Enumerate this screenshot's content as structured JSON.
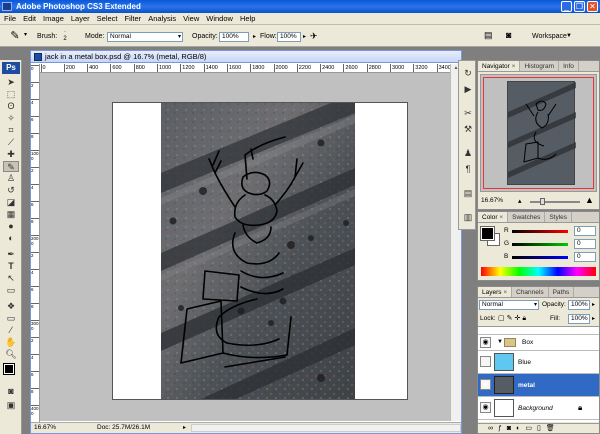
{
  "app": {
    "title": "Adobe Photoshop CS3 Extended",
    "logo": "Ps",
    "window_buttons": [
      "_",
      "❐",
      "✕"
    ]
  },
  "menu": [
    "File",
    "Edit",
    "Image",
    "Layer",
    "Select",
    "Filter",
    "Analysis",
    "View",
    "Window",
    "Help"
  ],
  "options": {
    "brush_label": "Brush:",
    "brush_size": "2",
    "mode_label": "Mode:",
    "mode_value": "Normal",
    "opacity_label": "Opacity:",
    "opacity_value": "100%",
    "flow_label": "Flow:",
    "flow_value": "100%",
    "workspace_label": "Workspace"
  },
  "document": {
    "title": "jack in a metal box.psd @ 16.7% (metal, RGB/8)",
    "zoom": "16.67%",
    "doc_size": "Doc: 25.7M/26.1M",
    "ruler_marks": [
      "0",
      "200",
      "400",
      "600",
      "800",
      "1000",
      "1200",
      "1400",
      "1600",
      "1800",
      "2000",
      "2200",
      "2400",
      "2600",
      "2800",
      "3000",
      "3200",
      "3400"
    ],
    "ruler_left_marks": [
      "0",
      "2",
      "4",
      "6",
      "8",
      "1000",
      "2",
      "4",
      "6",
      "8",
      "2000",
      "2",
      "4",
      "6",
      "8",
      "3000",
      "2",
      "4",
      "6",
      "8",
      "4000"
    ]
  },
  "navigator": {
    "tabs": [
      "Navigator",
      "Histogram",
      "Info"
    ],
    "zoom": "16.67%"
  },
  "color": {
    "tabs": [
      "Color",
      "Swatches",
      "Styles"
    ],
    "channels": [
      {
        "label": "R",
        "value": "0"
      },
      {
        "label": "G",
        "value": "0"
      },
      {
        "label": "B",
        "value": "0"
      }
    ]
  },
  "layers": {
    "tabs": [
      "Layers",
      "Channels",
      "Paths"
    ],
    "blend_mode": "Normal",
    "opacity_label": "Opacity:",
    "opacity_value": "100%",
    "lock_label": "Lock:",
    "fill_label": "Fill:",
    "fill_value": "100%",
    "items": [
      {
        "name": "Box"
      },
      {
        "name": "Blue"
      },
      {
        "name": "metal"
      },
      {
        "name": "Background"
      }
    ]
  },
  "colors": {
    "title_blue": "#0a57d8",
    "selected_layer": "#316ac5",
    "blue_layer": "#5ec8f0",
    "chrome": "#ece9d8",
    "metal_dark": "#454a4f",
    "metal_rust": "#7a4b38"
  }
}
